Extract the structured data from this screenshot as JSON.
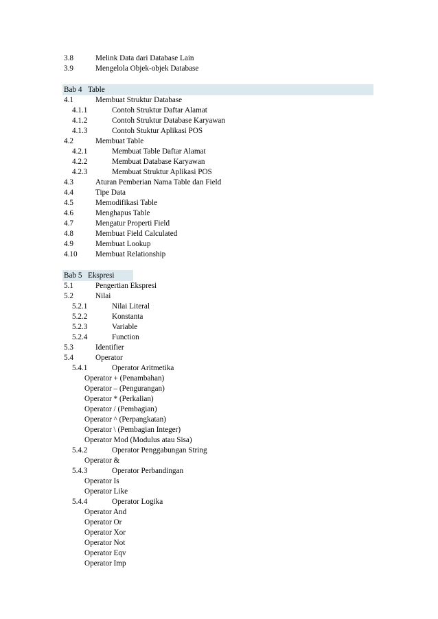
{
  "document": {
    "type": "table-of-contents",
    "highlight_color": "#dbe9ef",
    "page_background": "#ffffff",
    "text_color": "#000000"
  },
  "entries": [
    {
      "kind": "lvl1",
      "num": "3.8",
      "text": "Melink Data dari Database Lain"
    },
    {
      "kind": "lvl1",
      "num": "3.9",
      "text": "Mengelola Objek-objek Database"
    },
    {
      "kind": "spacer"
    },
    {
      "kind": "chapter",
      "num": "Bab 4",
      "text": "Table",
      "highlight": "wide"
    },
    {
      "kind": "lvl1",
      "num": "4.1",
      "text": "Membuat Struktur Database"
    },
    {
      "kind": "lvl2",
      "num": "4.1.1",
      "text": "Contoh Struktur Daftar Alamat"
    },
    {
      "kind": "lvl2",
      "num": "4.1.2",
      "text": "Contoh Struktur Database Karyawan"
    },
    {
      "kind": "lvl2",
      "num": "4.1.3",
      "text": "Contoh Stuktur Aplikasi POS"
    },
    {
      "kind": "lvl1",
      "num": "4.2",
      "text": "Membuat Table"
    },
    {
      "kind": "lvl2",
      "num": "4.2.1",
      "text": "Membuat Table Daftar Alamat"
    },
    {
      "kind": "lvl2",
      "num": "4.2.2",
      "text": "Membuat Database Karyawan"
    },
    {
      "kind": "lvl2",
      "num": "4.2.3",
      "text": "Membuat Struktur Aplikasi POS"
    },
    {
      "kind": "lvl1",
      "num": "4.3",
      "text": "Aturan Pemberian Nama Table dan Field"
    },
    {
      "kind": "lvl1",
      "num": "4.4",
      "text": "Tipe Data"
    },
    {
      "kind": "lvl1",
      "num": "4.5",
      "text": "Memodifikasi Table"
    },
    {
      "kind": "lvl1",
      "num": "4.6",
      "text": "Menghapus Table"
    },
    {
      "kind": "lvl1",
      "num": "4.7",
      "text": "Mengatur Properti Field"
    },
    {
      "kind": "lvl1",
      "num": "4.8",
      "text": "Membuat Field Calculated"
    },
    {
      "kind": "lvl1",
      "num": "4.9",
      "text": "Membuat Lookup"
    },
    {
      "kind": "lvl1",
      "num": "4.10",
      "text": "Membuat Relationship"
    },
    {
      "kind": "spacer"
    },
    {
      "kind": "chapter",
      "num": "Bab 5",
      "text": "Ekspresi",
      "highlight": "snug"
    },
    {
      "kind": "lvl1",
      "num": "5.1",
      "text": "Pengertian Ekspresi"
    },
    {
      "kind": "lvl1",
      "num": "5.2",
      "text": "Nilai"
    },
    {
      "kind": "lvl2",
      "num": "5.2.1",
      "text": "Nilai Literal"
    },
    {
      "kind": "lvl2",
      "num": "5.2.2",
      "text": "Konstanta"
    },
    {
      "kind": "lvl2",
      "num": "5.2.3",
      "text": "Variable"
    },
    {
      "kind": "lvl2",
      "num": "5.2.4",
      "text": "Function"
    },
    {
      "kind": "lvl1",
      "num": "5.3",
      "text": "Identifier"
    },
    {
      "kind": "lvl1",
      "num": "5.4",
      "text": "Operator"
    },
    {
      "kind": "lvl2",
      "num": "5.4.1",
      "text": "Operator Aritmetika"
    },
    {
      "kind": "lvlop",
      "num": "",
      "text": "Operator + (Penambahan)"
    },
    {
      "kind": "lvlop",
      "num": "",
      "text": "Operator – (Pengurangan)"
    },
    {
      "kind": "lvlop",
      "num": "",
      "text": "Operator * (Perkalian)"
    },
    {
      "kind": "lvlop",
      "num": "",
      "text": "Operator / (Pembagian)"
    },
    {
      "kind": "lvlop",
      "num": "",
      "text": "Operator ^ (Perpangkatan)"
    },
    {
      "kind": "lvlop",
      "num": "",
      "text": "Operator \\ (Pembagian Integer)"
    },
    {
      "kind": "lvlop",
      "num": "",
      "text": "Operator Mod (Modulus atau Sisa)"
    },
    {
      "kind": "lvl2",
      "num": "5.4.2",
      "text": "Operator Penggabungan String"
    },
    {
      "kind": "lvlop",
      "num": "",
      "text": "Operator &"
    },
    {
      "kind": "lvl2",
      "num": "5.4.3",
      "text": "Operator Perbandingan"
    },
    {
      "kind": "lvlop",
      "num": "",
      "text": "Operator Is"
    },
    {
      "kind": "lvlop",
      "num": "",
      "text": "Operator Like"
    },
    {
      "kind": "lvl2",
      "num": "5.4.4",
      "text": "Operator Logika"
    },
    {
      "kind": "lvlop",
      "num": "",
      "text": "Operator And"
    },
    {
      "kind": "lvlop",
      "num": "",
      "text": "Operator Or"
    },
    {
      "kind": "lvlop",
      "num": "",
      "text": "Operator Xor"
    },
    {
      "kind": "lvlop",
      "num": "",
      "text": "Operator Not"
    },
    {
      "kind": "lvlop",
      "num": "",
      "text": "Operator Eqv"
    },
    {
      "kind": "lvlop",
      "num": "",
      "text": "Operator Imp"
    }
  ]
}
